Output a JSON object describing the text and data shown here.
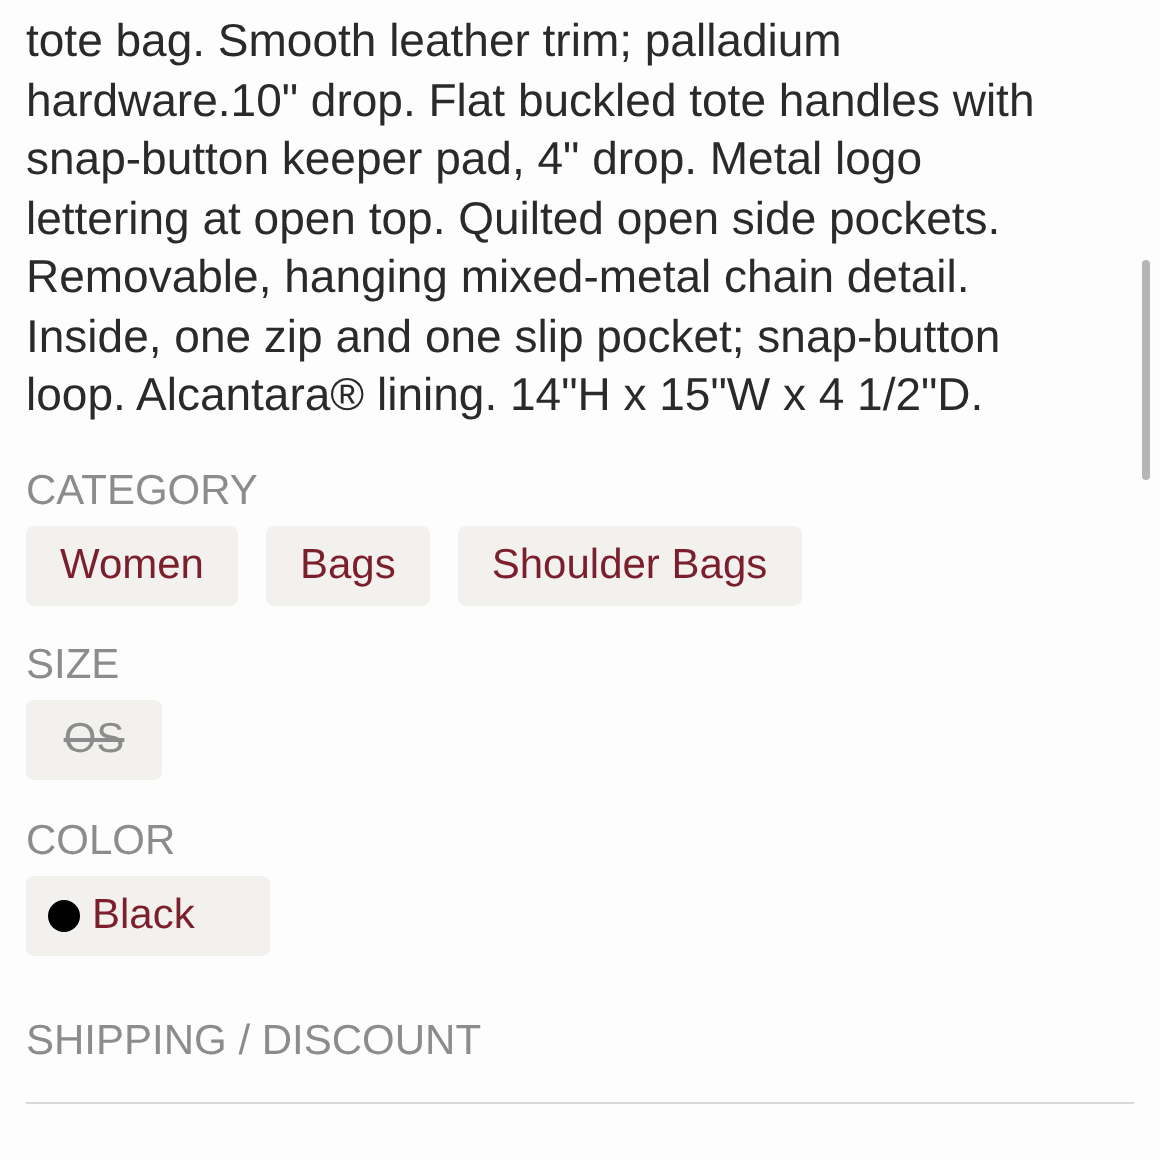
{
  "description_lines": [
    "tote bag. Smooth leather trim; palladium",
    "hardware.10\" drop. Flat buckled tote handles with",
    "snap-button keeper pad, 4\" drop. Metal logo",
    "lettering at open top. Quilted open side pockets.",
    "Removable, hanging mixed-metal chain detail.",
    "Inside, one zip and one slip pocket; snap-button",
    "loop. Alcantara® lining. 14\"H x 15\"W x 4 1/2\"D."
  ],
  "category": {
    "label": "CATEGORY",
    "chips": [
      "Women",
      "Bags",
      "Shoulder Bags"
    ]
  },
  "size": {
    "label": "SIZE",
    "options": [
      {
        "label": "OS",
        "disabled": true
      }
    ]
  },
  "color": {
    "label": "COLOR",
    "options": [
      {
        "label": "Black",
        "color": "#000000"
      }
    ]
  },
  "shipping": {
    "label": "SHIPPING / DISCOUNT"
  }
}
